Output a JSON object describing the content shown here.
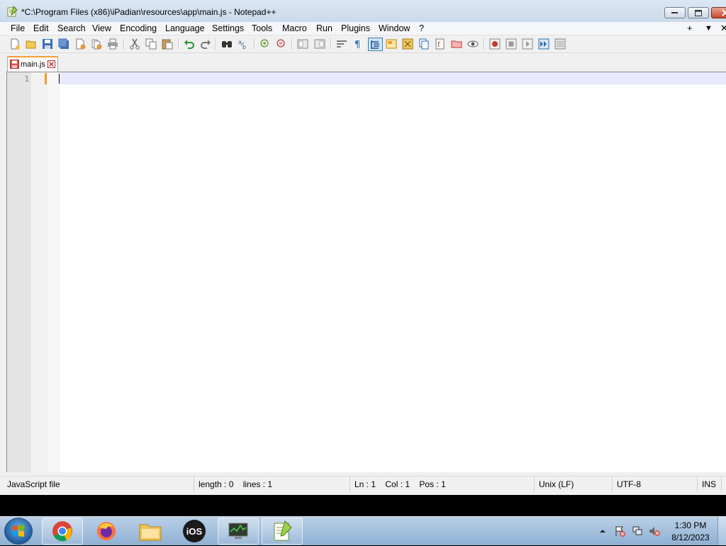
{
  "window": {
    "title": "*C:\\Program Files (x86)\\iPadian\\resources\\app\\main.js - Notepad++"
  },
  "menu": {
    "items": [
      "File",
      "Edit",
      "Search",
      "View",
      "Encoding",
      "Language",
      "Settings",
      "Tools",
      "Macro",
      "Run",
      "Plugins",
      "Window",
      "?"
    ],
    "right_plus": "+",
    "right_arrow": "▼",
    "right_close": "✕"
  },
  "toolbar": {
    "icons": [
      "new-file-icon",
      "open-file-icon",
      "save-icon",
      "save-all-icon",
      "close-icon",
      "close-all-icon",
      "print-icon",
      "cut-icon",
      "copy-icon",
      "paste-icon",
      "undo-icon",
      "redo-icon",
      "find-icon",
      "replace-icon",
      "zoom-in-icon",
      "zoom-out-icon",
      "sync-vertical-icon",
      "sync-horizontal-icon",
      "word-wrap-icon",
      "show-all-chars-icon",
      "indent-guide-icon",
      "udl-icon",
      "doc-map-icon",
      "doc-list-icon",
      "function-list-icon",
      "folder-workspace-icon",
      "monitoring-icon",
      "record-macro-icon",
      "stop-macro-icon",
      "play-macro-icon",
      "run-macro-multiple-icon",
      "save-macro-icon"
    ]
  },
  "tab": {
    "label": "main.js"
  },
  "editor": {
    "line_numbers": [
      "1"
    ]
  },
  "status": {
    "file_type": "JavaScript file",
    "length": "length : 0",
    "lines": "lines : 1",
    "ln": "Ln : 1",
    "col": "Col : 1",
    "pos": "Pos : 1",
    "eol": "Unix (LF)",
    "encoding": "UTF-8",
    "mode": "INS"
  },
  "taskbar": {
    "apps": [
      "chrome-icon",
      "firefox-icon",
      "file-explorer-icon",
      "ios-icon",
      "task-manager-icon",
      "notepadpp-icon"
    ],
    "ios_label": "iOS",
    "time": "1:30 PM",
    "date": "8/12/2023"
  },
  "colors": {
    "tab_accent": "#f8a033",
    "current_line": "#e8e8ff",
    "taskbar": "#a7c1dc"
  }
}
